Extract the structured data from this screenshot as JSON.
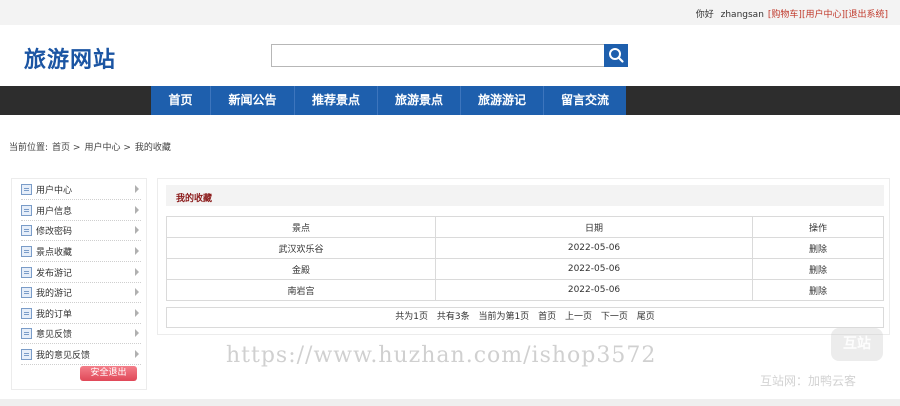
{
  "topbar": {
    "greeting": "你好",
    "username": "zhangsan",
    "cart_link": "[购物车]",
    "user_center_link": "[用户中心]",
    "logout_link": "[退出系统]"
  },
  "header": {
    "logo": "旅游网站",
    "search": {
      "value": "",
      "placeholder": ""
    },
    "search_icon": "search-icon"
  },
  "nav": {
    "items": [
      "首页",
      "新闻公告",
      "推荐景点",
      "旅游景点",
      "旅游游记",
      "留言交流"
    ]
  },
  "breadcrumb": {
    "label": "当前位置:",
    "items": [
      "首页 >",
      "用户中心 >",
      "我的收藏"
    ]
  },
  "sidebar": {
    "items": [
      {
        "label": "用户中心",
        "icon": "user-card-icon"
      },
      {
        "label": "用户信息",
        "icon": "user-card-icon"
      },
      {
        "label": "修改密码",
        "icon": "document-icon"
      },
      {
        "label": "景点收藏",
        "icon": "document-icon"
      },
      {
        "label": "发布游记",
        "icon": "document-icon"
      },
      {
        "label": "我的游记",
        "icon": "document-icon"
      },
      {
        "label": "我的订单",
        "icon": "document-icon"
      },
      {
        "label": "意见反馈",
        "icon": "document-icon"
      },
      {
        "label": "我的意见反馈",
        "icon": "document-icon"
      }
    ],
    "logout_label": "安全退出"
  },
  "main": {
    "title": "我的收藏",
    "table": {
      "headers": [
        "景点",
        "日期",
        "操作"
      ],
      "rows": [
        [
          "武汉欢乐谷",
          "2022-05-06",
          "删除"
        ],
        [
          "金殿",
          "2022-05-06",
          "删除"
        ],
        [
          "南岩宫",
          "2022-05-06",
          "删除"
        ]
      ]
    },
    "pager": {
      "total_pages": "共为1页",
      "total_items": "共有3条",
      "current": "当前为第1页",
      "first": "首页",
      "prev": "上一页",
      "next": "下一页",
      "last": "尾页"
    }
  },
  "watermark": {
    "url": "https://www.huzhan.com/ishop3572",
    "badge": "互站",
    "credit": "互站网：加鸭云客"
  },
  "colors": {
    "brand_blue": "#1e5fad",
    "nav_band": "#2d2d2d",
    "link_red": "#c0392b",
    "title_red": "#8b1a1a",
    "logout_pink": "#e04858"
  }
}
